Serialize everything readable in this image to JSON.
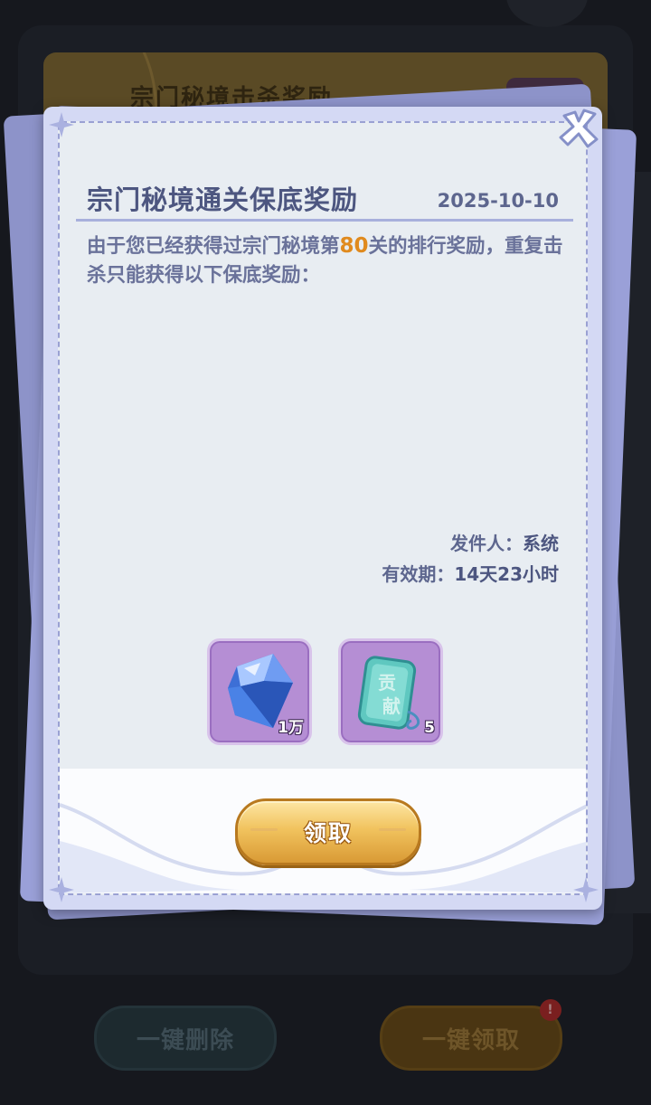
{
  "background": {
    "header_title": "宗门秘境击杀奖励",
    "delete_all_label": "一键删除",
    "claim_all_label": "一键领取",
    "claim_all_badge": "!"
  },
  "mail": {
    "title": "宗门秘境通关保底奖励",
    "date": "2025-10-10",
    "body_part1": "由于您已经获得过宗门秘境第",
    "body_highlight": "80",
    "body_part2": "关的排行奖励，重复击杀只能获得以下保底奖励：",
    "sender_label": "发件人：",
    "sender_value": "系统",
    "validity_label": "有效期：",
    "validity_value": "14天23小时"
  },
  "rewards": [
    {
      "icon": "blue-crystal-icon",
      "count": "1万"
    },
    {
      "icon": "contribution-token-icon",
      "glyph_top": "贡",
      "glyph_bottom": "献",
      "count": "5"
    }
  ],
  "actions": {
    "claim_label": "领取"
  },
  "colors": {
    "dialog_frame": "#d4d9f4",
    "dialog_paper": "#e8edf2",
    "title_text": "#4d5680",
    "body_text": "#6a729a",
    "highlight": "#e08a1e",
    "claim_button": "#f1c35e",
    "reward_slot": "#b58ed4"
  }
}
